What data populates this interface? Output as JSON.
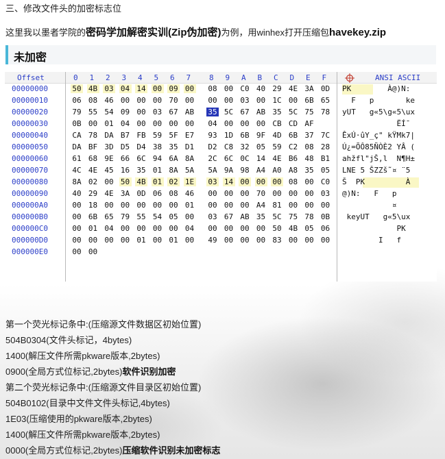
{
  "heading": "三、修改文件头的加密标志位",
  "intro": {
    "prefix": "这里我以墨者学院的",
    "bold1": "密码学加解密实训(Zip伪加密)",
    "middle": "为例，用winhex打开压缩包",
    "bold2": "havekey.zip"
  },
  "subtitle": "未加密",
  "hex_view": {
    "offset_header": "Offset",
    "column_headers": [
      "0",
      "1",
      "2",
      "3",
      "4",
      "5",
      "6",
      "7",
      "8",
      "9",
      "A",
      "B",
      "C",
      "D",
      "E",
      "F"
    ],
    "ascii_header": "ANSI ASCII",
    "rows": [
      {
        "offset": "00000000",
        "bytes": [
          "50",
          "4B",
          "03",
          "04",
          "14",
          "00",
          "09",
          "00",
          "08",
          "00",
          "C0",
          "40",
          "29",
          "4E",
          "3A",
          "0D"
        ],
        "ascii": "PK        À@)N:"
      },
      {
        "offset": "00000010",
        "bytes": [
          "06",
          "08",
          "46",
          "00",
          "00",
          "00",
          "70",
          "00",
          "00",
          "00",
          "03",
          "00",
          "1C",
          "00",
          "6B",
          "65"
        ],
        "ascii": "  F   p       ke"
      },
      {
        "offset": "00000020",
        "bytes": [
          "79",
          "55",
          "54",
          "09",
          "00",
          "03",
          "67",
          "AB",
          "35",
          "5C",
          "67",
          "AB",
          "35",
          "5C",
          "75",
          "78"
        ],
        "ascii": "yUT   g«5\\g«5\\ux"
      },
      {
        "offset": "00000030",
        "bytes": [
          "0B",
          "00",
          "01",
          "04",
          "00",
          "00",
          "00",
          "00",
          "04",
          "00",
          "00",
          "00",
          "CB",
          "CD",
          "AF"
        ],
        "ascii": "            ËÍ¯"
      },
      {
        "offset": "00000040",
        "bytes": [
          "CA",
          "78",
          "DA",
          "B7",
          "FB",
          "59",
          "5F",
          "E7",
          "93",
          "1D",
          "6B",
          "9F",
          "4D",
          "6B",
          "37",
          "7C"
        ],
        "ascii": "ÊxÚ·ûY_ç\" kŸMk7|"
      },
      {
        "offset": "00000050",
        "bytes": [
          "DA",
          "BF",
          "3D",
          "D5",
          "D4",
          "38",
          "35",
          "D1",
          "D2",
          "C8",
          "32",
          "05",
          "59",
          "C2",
          "08",
          "28"
        ],
        "ascii": "Ú¿=ÕÔ85ÑÒÈ2 YÂ ("
      },
      {
        "offset": "00000060",
        "bytes": [
          "61",
          "68",
          "9E",
          "66",
          "6C",
          "94",
          "6A",
          "8A",
          "2C",
          "6C",
          "0C",
          "14",
          "4E",
          "B6",
          "48",
          "B1"
        ],
        "ascii": "ahžfl\"jŠ,l  N¶H±"
      },
      {
        "offset": "00000070",
        "bytes": [
          "4C",
          "4E",
          "45",
          "16",
          "35",
          "01",
          "8A",
          "5A",
          "5A",
          "9A",
          "98",
          "A4",
          "A0",
          "A8",
          "35",
          "05"
        ],
        "ascii": "LNE 5 ŠZZš˜¤ ¨5"
      },
      {
        "offset": "00000080",
        "bytes": [
          "8A",
          "02",
          "00",
          "50",
          "4B",
          "01",
          "02",
          "1E",
          "03",
          "14",
          "00",
          "00",
          "00",
          "08",
          "00",
          "C0"
        ],
        "ascii": "Š  PK         À"
      },
      {
        "offset": "00000090",
        "bytes": [
          "40",
          "29",
          "4E",
          "3A",
          "0D",
          "06",
          "08",
          "46",
          "00",
          "00",
          "00",
          "70",
          "00",
          "00",
          "00",
          "03"
        ],
        "ascii": "@)N:   F   p   "
      },
      {
        "offset": "000000A0",
        "bytes": [
          "00",
          "18",
          "00",
          "00",
          "00",
          "00",
          "00",
          "01",
          "00",
          "00",
          "00",
          "A4",
          "81",
          "00",
          "00",
          "00"
        ],
        "ascii": "           ¤   "
      },
      {
        "offset": "000000B0",
        "bytes": [
          "00",
          "6B",
          "65",
          "79",
          "55",
          "54",
          "05",
          "00",
          "03",
          "67",
          "AB",
          "35",
          "5C",
          "75",
          "78",
          "0B"
        ],
        "ascii": " keyUT   g«5\\ux"
      },
      {
        "offset": "000000C0",
        "bytes": [
          "00",
          "01",
          "04",
          "00",
          "00",
          "00",
          "00",
          "04",
          "00",
          "00",
          "00",
          "00",
          "50",
          "4B",
          "05",
          "06"
        ],
        "ascii": "            PK"
      },
      {
        "offset": "000000D0",
        "bytes": [
          "00",
          "00",
          "00",
          "00",
          "01",
          "00",
          "01",
          "00",
          "49",
          "00",
          "00",
          "00",
          "83",
          "00",
          "00",
          "00"
        ],
        "ascii": "        I   f"
      },
      {
        "offset": "000000E0",
        "bytes": [
          "00",
          "00"
        ],
        "ascii": ""
      }
    ]
  },
  "notes": [
    {
      "text": "第一个荧光标记条中:(压缩源文件数据区初始位置)",
      "bold": ""
    },
    {
      "text": "504B0304(文件头标记，4bytes)",
      "bold": ""
    },
    {
      "text": "1400(解压文件所需pkware版本,2bytes)",
      "bold": ""
    },
    {
      "text": "0900(全局方式位标记,2bytes)",
      "bold": "软件识别加密"
    },
    {
      "text": "第二个荧光标记条中:(压缩源文件目录区初始位置)",
      "bold": ""
    },
    {
      "text": "504B0102(目录中文件文件头标记,4bytes)",
      "bold": ""
    },
    {
      "text": "1E03(压缩使用的pkware版本,2bytes)",
      "bold": ""
    },
    {
      "text": "1400(解压文件所需pkware版本,2bytes)",
      "bold": ""
    },
    {
      "text": "0000(全局方式位标记,2bytes)",
      "bold": "压缩软件识别未加密标志"
    }
  ]
}
